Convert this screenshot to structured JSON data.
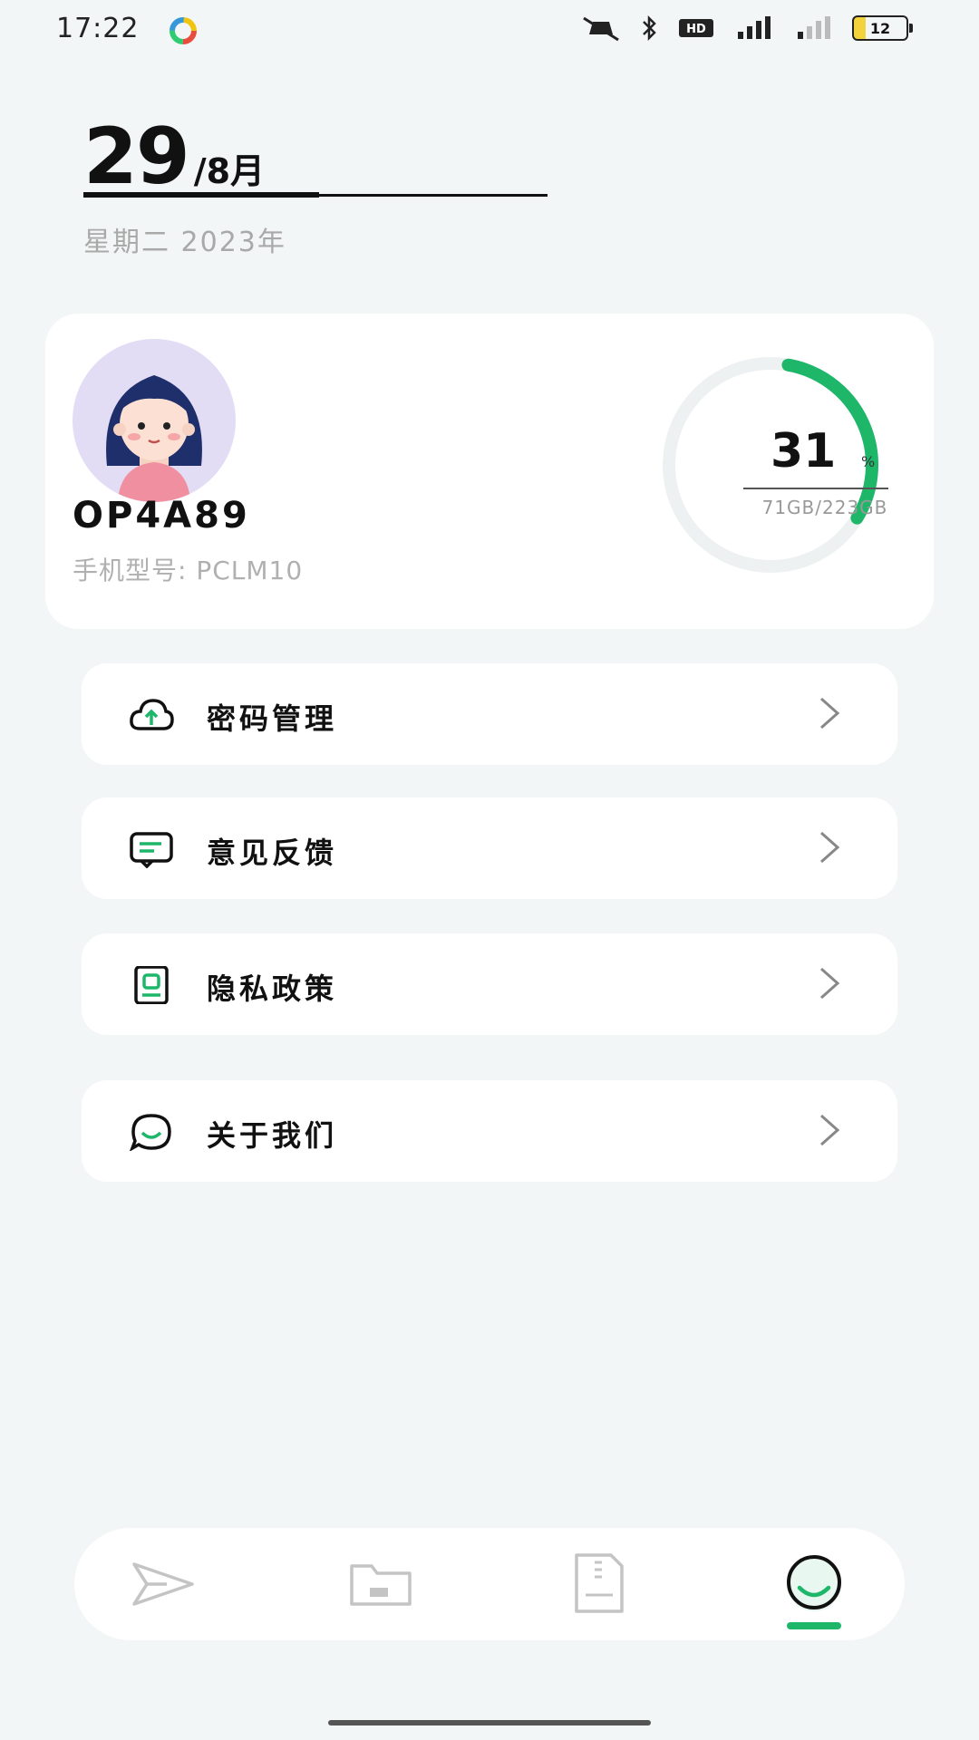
{
  "status_bar": {
    "time": "17:22",
    "battery": "12",
    "icons": [
      "app-icon",
      "mute-icon",
      "bluetooth-icon",
      "hd-icon",
      "signal-icon",
      "signal-icon-2",
      "battery-icon"
    ]
  },
  "date": {
    "day": "29",
    "month": "/8月",
    "weekday_year": "星期二  2023年"
  },
  "profile": {
    "device_name": "OP4A89",
    "device_model": "手机型号: PCLM10",
    "storage_percent": "31",
    "storage_percent_unit": "%",
    "storage_used": "71GB/223GB",
    "storage_fraction": 0.31
  },
  "menu": {
    "items": [
      {
        "label": "密码管理",
        "icon": "cloud-upload-icon"
      },
      {
        "label": "意见反馈",
        "icon": "message-icon"
      },
      {
        "label": "隐私政策",
        "icon": "document-icon"
      },
      {
        "label": "关于我们",
        "icon": "chat-smile-icon"
      }
    ]
  },
  "bottom_nav": {
    "items": [
      {
        "icon": "send-icon",
        "active": false
      },
      {
        "icon": "folder-icon",
        "active": false
      },
      {
        "icon": "file-zip-icon",
        "active": false
      },
      {
        "icon": "profile-smile-icon",
        "active": true
      }
    ]
  },
  "colors": {
    "accent": "#1eb76a",
    "background": "#f3f6f6",
    "card": "#ffffff"
  }
}
